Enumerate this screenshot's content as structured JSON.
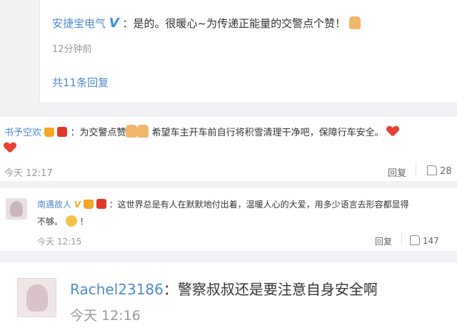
{
  "reply_panel": {
    "username": "安捷宝电气",
    "verified_mark": "V",
    "text": "：是的。很暖心~为传递正能量的交警点个赞！",
    "time": "12分钟前",
    "more_replies": "共11条回复"
  },
  "comments": [
    {
      "username": "书予空欢",
      "text": "：为交警点赞",
      "text_after": "希望车主开车前自行将积雪清理干净吧，保障行车安全。",
      "time": "今天 12:17",
      "reply_label": "回复",
      "likes": "28"
    },
    {
      "username": "南遇故人",
      "verified_mark": "V",
      "text": "：这世界总是有人在默默地付出着，温暖人心的大爱，用多少语言去形容都显得",
      "text_line2": "不够。",
      "text_line2_end": "！",
      "time": "今天 12:15",
      "reply_label": "回复",
      "likes": "147"
    },
    {
      "username": "Rachel23186",
      "text": "：警察叔叔还是要注意自身安全啊",
      "time": "今天 12:16"
    }
  ],
  "colors": {
    "username_blue": "#4e8bd0",
    "background_gray": "#f2f2f5",
    "heart_red": "#e84236"
  }
}
